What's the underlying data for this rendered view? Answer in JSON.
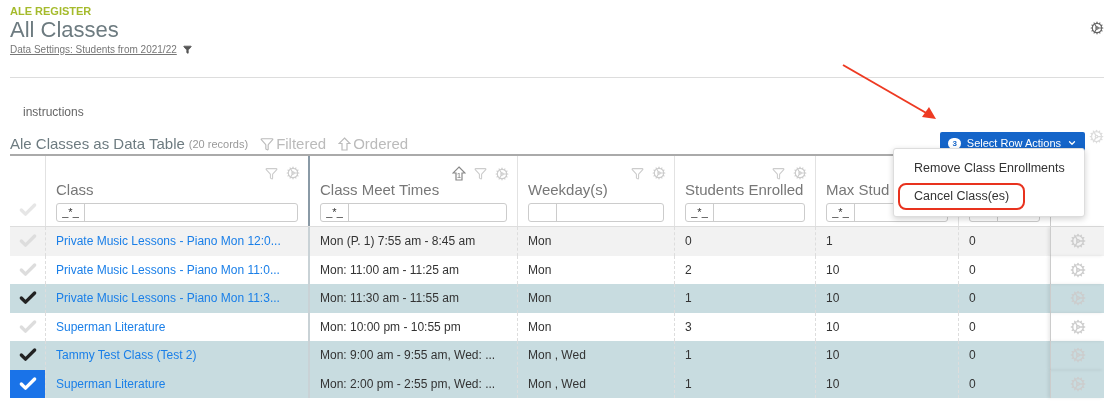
{
  "header": {
    "module": "ALE REGISTER",
    "title": "All Classes",
    "data_settings": "Data Settings: Students from 2021/22"
  },
  "instructions": "instructions",
  "table_title": {
    "title": "Ale Classes as Data Table",
    "count": "(20 records)",
    "filtered": "Filtered",
    "ordered": "Ordered"
  },
  "row_actions": {
    "badge": "3",
    "label": "Select Row Actions",
    "menu": [
      {
        "label": "Remove Class Enrollments",
        "highlighted": false
      },
      {
        "label": "Cancel Class(es)",
        "highlighted": true
      }
    ]
  },
  "columns": [
    {
      "kind": "tools",
      "name": "Class",
      "filter_prefix": "_*_"
    },
    {
      "kind": "tools",
      "name": "Class Meet Times",
      "filter_prefix": "_*_",
      "sort_order": "1"
    },
    {
      "kind": "tools",
      "name": "Weekday(s)"
    },
    {
      "kind": "tools",
      "name": "Students Enrolled",
      "filter_prefix": "_*_"
    },
    {
      "kind": "plain",
      "name": "Max Stud",
      "filter_prefix": "_*_"
    },
    {
      "kind": "plain"
    }
  ],
  "all_selected": false,
  "rows": [
    {
      "selected": false,
      "focused": false,
      "cells": [
        "Private Music Lessons - Piano Mon 12:0...",
        "Mon (P. 1) 7:55 am - 8:45 am",
        "Mon",
        "0",
        "1",
        "0"
      ]
    },
    {
      "selected": false,
      "focused": false,
      "cells": [
        "Private Music Lessons - Piano Mon 11:0...",
        "Mon: 11:00 am - 11:25 am",
        "Mon",
        "2",
        "10",
        "0"
      ]
    },
    {
      "selected": true,
      "focused": false,
      "cells": [
        "Private Music Lessons - Piano Mon 11:3...",
        "Mon: 11:30 am - 11:55 am",
        "Mon",
        "1",
        "10",
        "0"
      ]
    },
    {
      "selected": false,
      "focused": false,
      "cells": [
        "Superman Literature",
        "Mon: 10:00 pm - 10:55 pm",
        "Mon",
        "3",
        "10",
        "0"
      ]
    },
    {
      "selected": true,
      "focused": false,
      "cells": [
        "Tammy Test Class (Test 2)",
        "Mon: 9:00 am - 9:55 am, Wed: ...",
        "Mon , Wed",
        "1",
        "10",
        "0"
      ]
    },
    {
      "selected": true,
      "focused": true,
      "cells": [
        "Superman Literature",
        "Mon: 2:00 pm - 2:55 pm, Wed: ...",
        "Mon , Wed",
        "1",
        "10",
        "0"
      ]
    }
  ]
}
